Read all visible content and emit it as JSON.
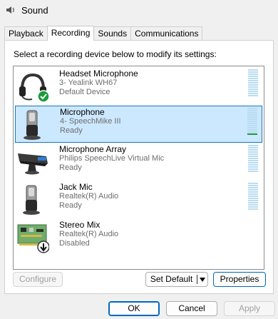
{
  "window": {
    "title": "Sound"
  },
  "tabs": [
    {
      "label": "Playback"
    },
    {
      "label": "Recording"
    },
    {
      "label": "Sounds"
    },
    {
      "label": "Communications"
    }
  ],
  "instruction": "Select a recording device below to modify its settings:",
  "devices": [
    {
      "name": "Headset Microphone",
      "line2": "3- Yealink WH67",
      "line3": "Default Device",
      "icon": "headset-icon",
      "level": 0
    },
    {
      "name": "Microphone",
      "line2": "4- SpeechMike III",
      "line3": "Ready",
      "icon": "handheld-mic-icon",
      "level": 0.08,
      "selected": true
    },
    {
      "name": "Microphone Array",
      "line2": "Philips SpeechLive Virtual Mic",
      "line3": "Ready",
      "icon": "mic-array-icon",
      "level": 0
    },
    {
      "name": "Jack Mic",
      "line2": "Realtek(R) Audio",
      "line3": "Ready",
      "icon": "handheld-mic-icon",
      "level": 0
    },
    {
      "name": "Stereo Mix",
      "line2": "Realtek(R) Audio",
      "line3": "Disabled",
      "icon": "circuit-board-icon",
      "level": null
    }
  ],
  "buttons": {
    "configure": "Configure",
    "set_default": "Set Default",
    "properties": "Properties",
    "ok": "OK",
    "cancel": "Cancel",
    "apply": "Apply"
  },
  "colors": {
    "selection_bg": "#cce8ff",
    "selection_border": "#1a73c0",
    "meter_idle": "#b9dcf0",
    "meter_active": "#1d9b3a",
    "default_badge": "#1a9b3a"
  }
}
